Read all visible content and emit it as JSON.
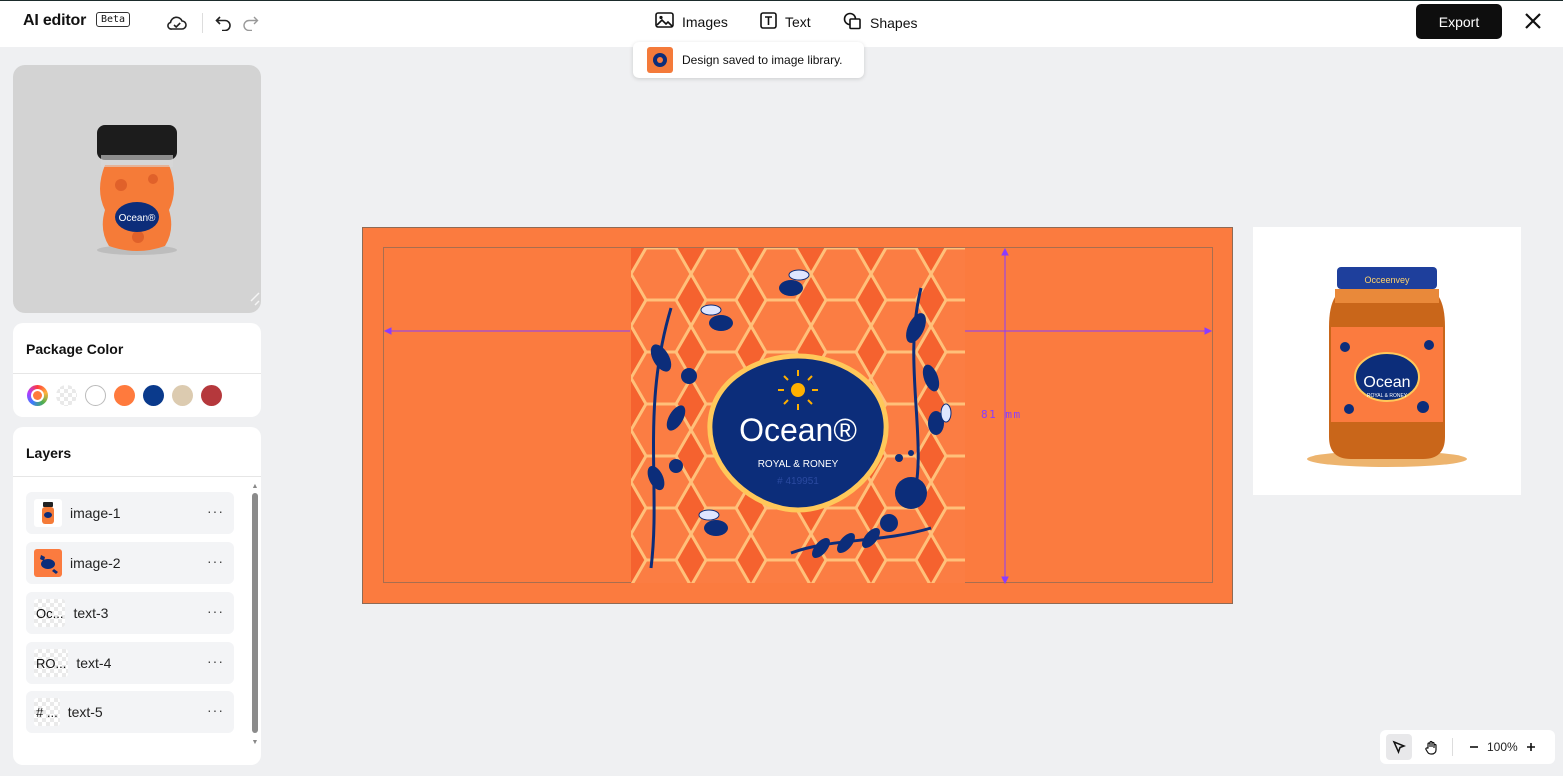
{
  "header": {
    "app_title": "AI editor",
    "beta_badge": "Beta",
    "tools": [
      {
        "label": "Images"
      },
      {
        "label": "Text"
      },
      {
        "label": "Shapes"
      }
    ],
    "export_label": "Export"
  },
  "toast": {
    "message": "Design saved to image library."
  },
  "package_color": {
    "title": "Package Color",
    "swatches": [
      "#ff7a3d",
      "#0a3a8c",
      "#dccbb0",
      "#b5383c"
    ]
  },
  "layers": {
    "title": "Layers",
    "items": [
      {
        "name": "image-1",
        "thumb_text": ""
      },
      {
        "name": "image-2",
        "thumb_text": ""
      },
      {
        "name": "text-3",
        "thumb_text": "Oc..."
      },
      {
        "name": "text-4",
        "thumb_text": "RO..."
      },
      {
        "name": "text-5",
        "thumb_text": "# ..."
      }
    ],
    "more_label": "···"
  },
  "canvas": {
    "brand_text": "Ocean®",
    "tagline": "ROYAL & RONEY",
    "code_text": "# 419951",
    "dimension_label": "81 mm",
    "colors": {
      "background": "#fb7b3f",
      "badge": "#0c2d7a",
      "measure": "#8a3cff"
    }
  },
  "preview_jar": {
    "brand_text": "Ocean",
    "tagline": "ROYAL & RONEY",
    "lid_text": "Occeenvey"
  },
  "zoom": {
    "value": "100%"
  }
}
